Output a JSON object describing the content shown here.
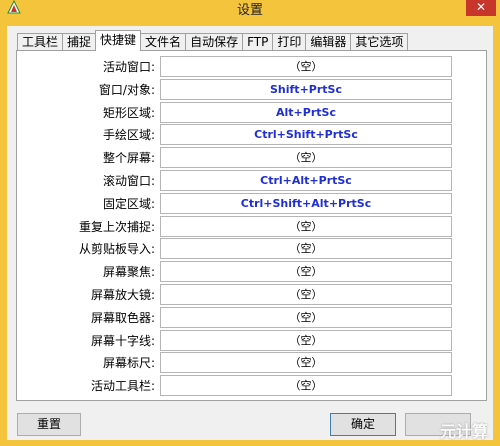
{
  "window": {
    "title": "设置",
    "close_label": "✕"
  },
  "tabs": [
    {
      "label": "工具栏",
      "active": false
    },
    {
      "label": "捕捉",
      "active": false
    },
    {
      "label": "快捷键",
      "active": true
    },
    {
      "label": "文件名",
      "active": false
    },
    {
      "label": "自动保存",
      "active": false
    },
    {
      "label": "FTP",
      "active": false
    },
    {
      "label": "打印",
      "active": false
    },
    {
      "label": "编辑器",
      "active": false
    },
    {
      "label": "其它选项",
      "active": false
    }
  ],
  "hotkeys": [
    {
      "label": "活动窗口:",
      "value": "（空）",
      "set": false
    },
    {
      "label": "窗口/对象:",
      "value": "Shift+PrtSc",
      "set": true
    },
    {
      "label": "矩形区域:",
      "value": "Alt+PrtSc",
      "set": true
    },
    {
      "label": "手绘区域:",
      "value": "Ctrl+Shift+PrtSc",
      "set": true
    },
    {
      "label": "整个屏幕:",
      "value": "（空）",
      "set": false
    },
    {
      "label": "滚动窗口:",
      "value": "Ctrl+Alt+PrtSc",
      "set": true
    },
    {
      "label": "固定区域:",
      "value": "Ctrl+Shift+Alt+PrtSc",
      "set": true
    },
    {
      "label": "重复上次捕捉:",
      "value": "（空）",
      "set": false
    },
    {
      "label": "从剪贴板导入:",
      "value": "（空）",
      "set": false
    },
    {
      "label": "屏幕聚焦:",
      "value": "（空）",
      "set": false
    },
    {
      "label": "屏幕放大镜:",
      "value": "（空）",
      "set": false
    },
    {
      "label": "屏幕取色器:",
      "value": "（空）",
      "set": false
    },
    {
      "label": "屏幕十字线:",
      "value": "（空）",
      "set": false
    },
    {
      "label": "屏幕标尺:",
      "value": "（空）",
      "set": false
    },
    {
      "label": "活动工具栏:",
      "value": "（空）",
      "set": false
    }
  ],
  "buttons": {
    "reset": "重置",
    "ok": "确定"
  },
  "watermark": "元计算",
  "colors": {
    "frame": "#f4c43c",
    "close": "#c7352b",
    "hotkey_set": "#1f2fd2"
  }
}
